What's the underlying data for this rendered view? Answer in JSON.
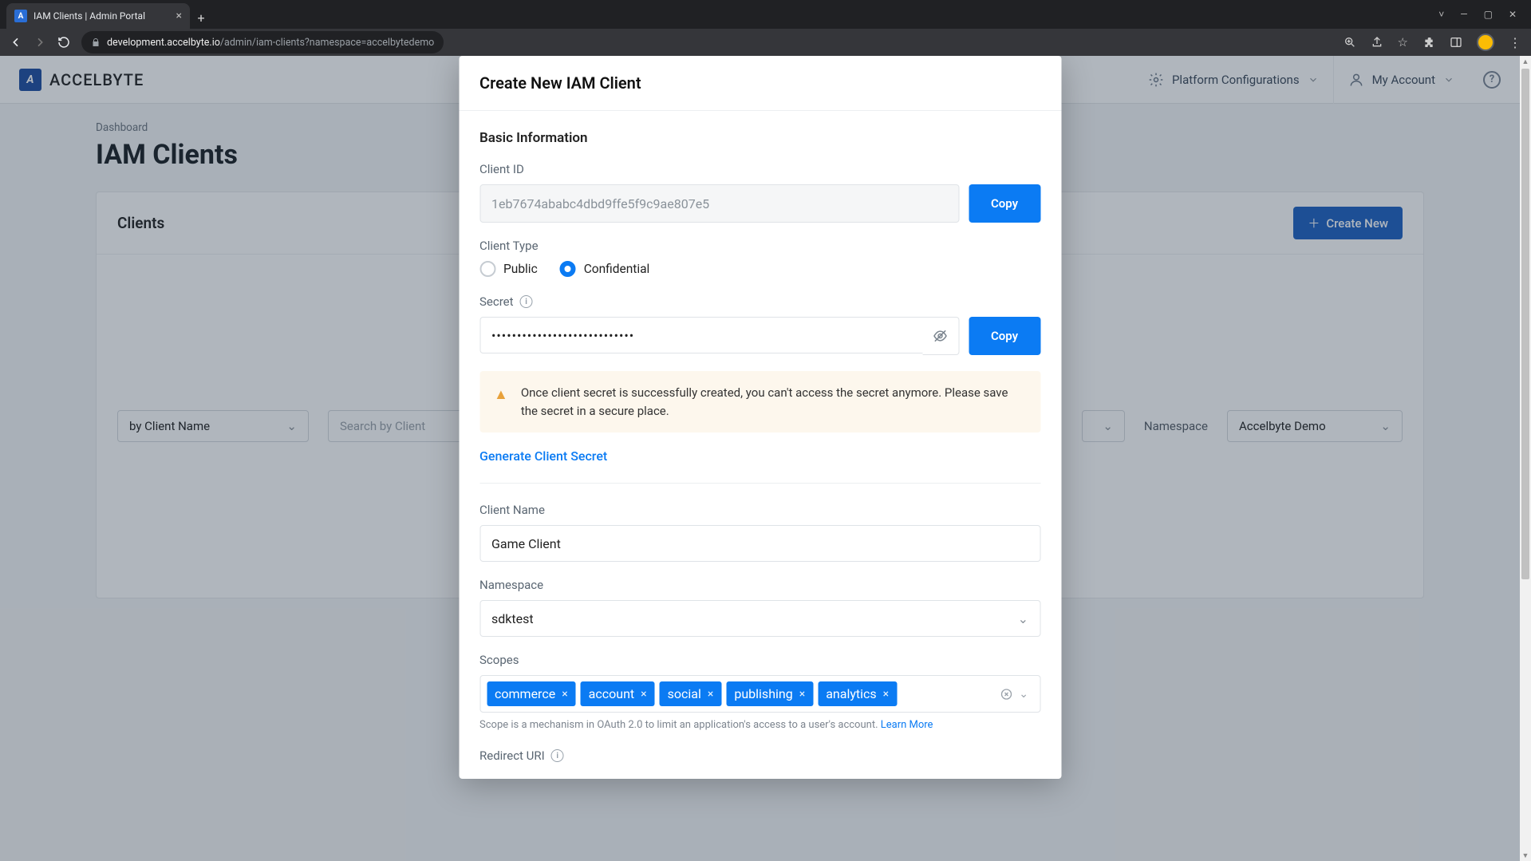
{
  "browser": {
    "tab_title": "IAM Clients | Admin Portal",
    "url_host": "development.accelbyte.io",
    "url_path": "/admin/iam-clients?namespace=accelbytedemo"
  },
  "topbar": {
    "brand": "ACCELBYTE",
    "platform_config": "Platform Configurations",
    "my_account": "My Account"
  },
  "page": {
    "breadcrumb": "Dashboard",
    "title": "IAM Clients"
  },
  "card": {
    "title": "Clients",
    "create_btn": "Create New",
    "filter_by": "by Client Name",
    "search_placeholder": "Search by Client",
    "namespace_label": "Namespace",
    "namespace_value": "Accelbyte Demo"
  },
  "modal": {
    "title": "Create New IAM Client",
    "section_basic": "Basic Information",
    "client_id_label": "Client ID",
    "client_id_value": "1eb7674ababc4dbd9ffe5f9c9ae807e5",
    "copy": "Copy",
    "client_type_label": "Client Type",
    "type_public": "Public",
    "type_confidential": "Confidential",
    "secret_label": "Secret",
    "secret_value": "••••••••••••••••••••••••••••",
    "warn_text": "Once client secret is successfully created, you can't access the secret anymore. Please save the secret in a secure place.",
    "generate_secret": "Generate Client Secret",
    "client_name_label": "Client Name",
    "client_name_value": "Game Client",
    "namespace_label": "Namespace",
    "namespace_value": "sdktest",
    "scopes_label": "Scopes",
    "scopes": [
      "commerce",
      "account",
      "social",
      "publishing",
      "analytics"
    ],
    "scopes_helper": "Scope is a mechanism in OAuth 2.0 to limit an application's access to a user's account. ",
    "scopes_learn": "Learn More",
    "redirect_label": "Redirect URI"
  }
}
